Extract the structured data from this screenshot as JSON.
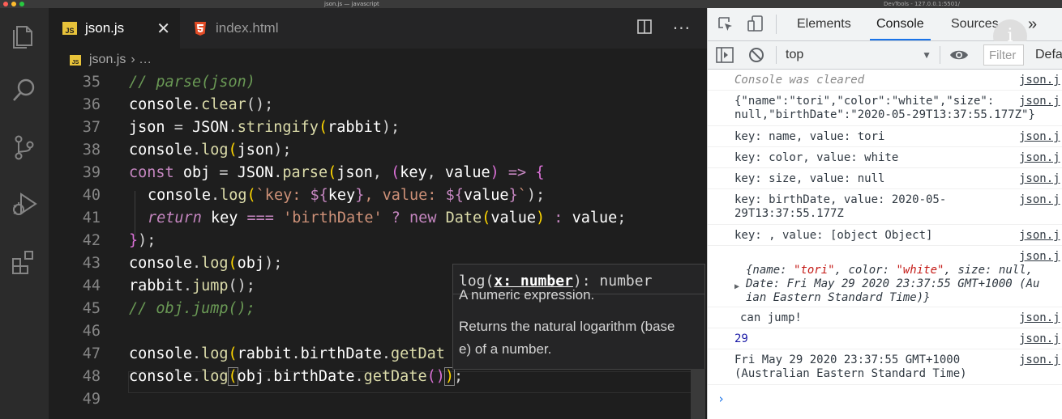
{
  "window": {
    "title": "json.js — javascript",
    "devtools_title": "DevTools - 127.0.0.1:5501/"
  },
  "editor": {
    "tabs": [
      {
        "label": "json.js",
        "badge": "JS",
        "active": true
      },
      {
        "label": "index.html",
        "active": false
      }
    ],
    "breadcrumb": {
      "file": "json.js",
      "badge": "JS",
      "rest": "›  …"
    },
    "lines": [
      {
        "n": "35"
      },
      {
        "n": "36"
      },
      {
        "n": "37"
      },
      {
        "n": "38"
      },
      {
        "n": "39"
      },
      {
        "n": "40"
      },
      {
        "n": "41"
      },
      {
        "n": "42"
      },
      {
        "n": "43"
      },
      {
        "n": "44"
      },
      {
        "n": "45"
      },
      {
        "n": "46"
      },
      {
        "n": "47"
      },
      {
        "n": "48"
      },
      {
        "n": "49"
      }
    ],
    "code": {
      "l35": "// parse(json)",
      "l36a": "console",
      "l36b": ".",
      "l36c": "clear",
      "l36d": "();",
      "l37a": "json",
      "l37b": " = ",
      "l37c": "JSON",
      "l37d": ".",
      "l37e": "stringify",
      "l37f": "(",
      "l37g": "rabbit",
      "l37h": ");",
      "l38a": "console",
      "l38b": ".",
      "l38c": "log",
      "l38d": "(",
      "l38e": "json",
      "l38f": ");",
      "l39a": "const",
      "l39b": " obj",
      "l39c": " = ",
      "l39d": "JSON",
      "l39e": ".",
      "l39f": "parse",
      "l39g": "(",
      "l39h": "json",
      "l39i": ", ",
      "l39j": "(",
      "l39k": "key",
      "l39l": ", ",
      "l39m": "value",
      "l39n": ")",
      "l39o": " => ",
      "l39p": "{",
      "l40a": "console",
      "l40b": ".",
      "l40c": "log",
      "l40d": "(",
      "l40e": "`key: ",
      "l40f": "${",
      "l40g": "key",
      "l40h": "}",
      "l40i": ", value: ",
      "l40j": "${",
      "l40k": "value",
      "l40l": "}",
      "l40m": "`",
      "l40n": ");",
      "l41a": "return",
      "l41b": " key",
      "l41c": " === ",
      "l41d": "'birthDate'",
      "l41e": " ? ",
      "l41f": "new",
      "l41g": " Date",
      "l41h": "(",
      "l41i": "value",
      "l41j": ")",
      "l41k": " : ",
      "l41l": "value",
      "l41m": ";",
      "l42a": "}",
      "l42b": ");",
      "l43a": "console",
      "l43b": ".",
      "l43c": "log",
      "l43d": "(",
      "l43e": "obj",
      "l43f": ");",
      "l44a": "rabbit",
      "l44b": ".",
      "l44c": "jump",
      "l44d": "();",
      "l45": "// obj.jump();",
      "l47a": "console",
      "l47b": ".",
      "l47c": "log",
      "l47d": "(",
      "l47e": "rabbit",
      "l47f": ".",
      "l47g": "birthDate",
      "l47h": ".",
      "l47i": "getDat",
      "l48a": "console",
      "l48b": ".",
      "l48c": "log",
      "l48d": "(",
      "l48e": "obj",
      "l48f": ".",
      "l48g": "birthDate",
      "l48h": ".",
      "l48i": "getDate",
      "l48j": "()",
      "l48k": ")",
      "l48l": ";"
    },
    "tooltip": {
      "sig_pre": "log(",
      "sig_param": "x: number",
      "sig_post": "): number",
      "doc1": "A numeric expression.",
      "doc2a": "Returns the natural logarithm (base",
      "doc2b": "e) of a number."
    }
  },
  "devtools": {
    "tabs": [
      "Elements",
      "Console",
      "Sources",
      "»"
    ],
    "active_tab": "Console",
    "context": "top",
    "filter_placeholder": "Filter",
    "levels_label": "Defa",
    "info": "i",
    "messages": [
      {
        "text": "Console was cleared",
        "src": "json.j"
      },
      {
        "text1": "{\"name\":\"tori\",\"color\":\"white\",\"size\":",
        "text2": "null,\"birthDate\":\"2020-05-29T13:37:55.177Z\"}",
        "src": "json.j"
      },
      {
        "text": "key: name, value: tori",
        "src": "json.j"
      },
      {
        "text": "key: color, value: white",
        "src": "json.j"
      },
      {
        "text": "key: size, value: null",
        "src": "json.j"
      },
      {
        "text1": "key: birthDate, value: 2020-05-",
        "text2": "29T13:37:55.177Z",
        "src": "json.j"
      },
      {
        "text": "key: , value: [object Object]",
        "src": "json.j"
      },
      {
        "src": "json.j",
        "o_open": "{name: ",
        "o_name": "\"tori\"",
        "o_c": ", color: ",
        "o_color": "\"white\"",
        "o_s": ", size: ",
        "o_size": "null",
        "o_tail": ", ",
        "line2": "Date: Fri May 29 2020 23:37:55 GMT+1000 (Au",
        "line3": "ian Eastern Standard Time)}"
      },
      {
        "text": "can jump!",
        "src": "json.j"
      },
      {
        "text": "29",
        "src": "json.j"
      },
      {
        "text1": "Fri May 29 2020 23:37:55 GMT+1000",
        "text2": "(Australian Eastern Standard Time)",
        "src": "json.j"
      }
    ],
    "prompt": "›"
  },
  "colors": {
    "accent": "#1a73e8",
    "js_badge": "#e8c33a"
  }
}
